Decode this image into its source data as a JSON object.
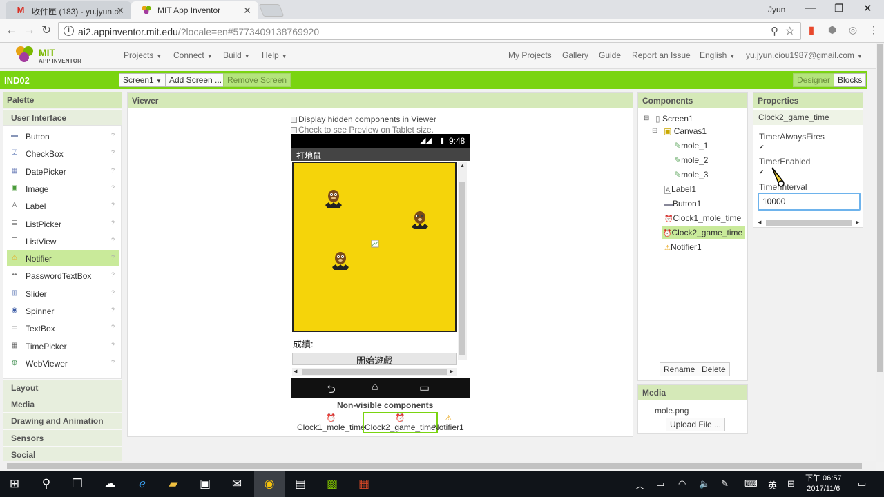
{
  "browser": {
    "tabs": [
      {
        "title": "收件匣 (183) - yu.jyun.ci",
        "icon": "gmail-icon"
      },
      {
        "title": "MIT App Inventor",
        "icon": "app-inventor-icon"
      }
    ],
    "user": "Jyun",
    "url_host": "ai2.appinventor.mit.edu",
    "url_path": "/?locale=en#5773409138769920"
  },
  "app": {
    "logo_text": "MIT",
    "logo_sub": "APP INVENTOR",
    "menu": [
      "Projects",
      "Connect",
      "Build",
      "Help"
    ],
    "right_menu": [
      "My Projects",
      "Gallery",
      "Guide",
      "Report an Issue",
      "English"
    ],
    "account": "yu.jyun.ciou1987@gmail.com"
  },
  "project": {
    "name": "IND02",
    "screen_select": "Screen1",
    "add_screen": "Add Screen ...",
    "remove_screen": "Remove Screen",
    "designer": "Designer",
    "blocks": "Blocks"
  },
  "palette": {
    "title": "Palette",
    "category": "User Interface",
    "items": [
      {
        "label": "Button",
        "icon": "button-icon"
      },
      {
        "label": "CheckBox",
        "icon": "checkbox-icon"
      },
      {
        "label": "DatePicker",
        "icon": "datepicker-icon"
      },
      {
        "label": "Image",
        "icon": "image-icon"
      },
      {
        "label": "Label",
        "icon": "label-icon"
      },
      {
        "label": "ListPicker",
        "icon": "listpicker-icon"
      },
      {
        "label": "ListView",
        "icon": "listview-icon"
      },
      {
        "label": "Notifier",
        "icon": "notifier-icon"
      },
      {
        "label": "PasswordTextBox",
        "icon": "password-icon"
      },
      {
        "label": "Slider",
        "icon": "slider-icon"
      },
      {
        "label": "Spinner",
        "icon": "spinner-icon"
      },
      {
        "label": "TextBox",
        "icon": "textbox-icon"
      },
      {
        "label": "TimePicker",
        "icon": "timepicker-icon"
      },
      {
        "label": "WebViewer",
        "icon": "webviewer-icon"
      }
    ],
    "selected": "Notifier",
    "categories": [
      "Layout",
      "Media",
      "Drawing and Animation",
      "Sensors",
      "Social"
    ]
  },
  "viewer": {
    "title": "Viewer",
    "display_hidden": "Display hidden components in Viewer",
    "tablet_preview": "Check to see Preview on Tablet size.",
    "phone_time": "9:48",
    "app_title": "打地鼠",
    "score_label": "成績:",
    "start_button": "開始遊戲",
    "nonvisible_title": "Non-visible components",
    "nonvisible": [
      "Clock1_mole_time",
      "Clock2_game_time",
      "Notifier1"
    ]
  },
  "components": {
    "title": "Components",
    "tree": [
      "Screen1",
      "Canvas1",
      "mole_1",
      "mole_2",
      "mole_3",
      "Label1",
      "Button1",
      "Clock1_mole_time",
      "Clock2_game_time",
      "Notifier1"
    ],
    "selected": "Clock2_game_time",
    "rename": "Rename",
    "delete": "Delete"
  },
  "media": {
    "title": "Media",
    "file": "mole.png",
    "upload": "Upload File ..."
  },
  "properties": {
    "title": "Properties",
    "component": "Clock2_game_time",
    "timer_always_fires": "TimerAlwaysFires",
    "timer_enabled": "TimerEnabled",
    "timer_interval": "TimerInterval",
    "timer_interval_value": "10000"
  },
  "taskbar": {
    "ime": "英",
    "time": "下午 06:57",
    "date": "2017/11/6"
  },
  "colors": {
    "accent_green": "#7ad411",
    "panel_header": "#d5e9b8",
    "canvas_yellow": "#f5d40a"
  }
}
